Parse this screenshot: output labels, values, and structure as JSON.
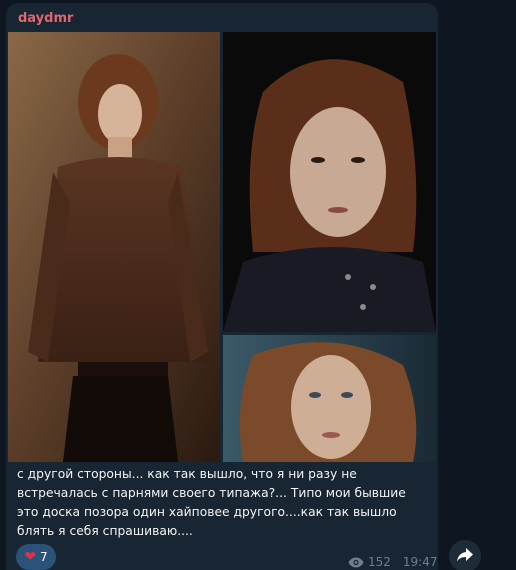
{
  "message": {
    "author": "daydmr",
    "caption": "с другой стороны... как так вышло, что я ни разу не встречалась с парнями своего типажа?... Типо мои бывшие это доска позора один хайповее другого....как так вышло блять я себя спрашиваю....",
    "reaction": {
      "emoji_icon": "heart-icon",
      "count": "7"
    },
    "views": "152",
    "time": "19:47"
  },
  "icons": {
    "views": "eye-icon",
    "share": "share-arrow-icon"
  },
  "colors": {
    "background": "#0e1621",
    "bubble": "#182533",
    "author": "#e0676e",
    "reaction_bg": "#2b5278",
    "meta": "#6d7f8f"
  }
}
